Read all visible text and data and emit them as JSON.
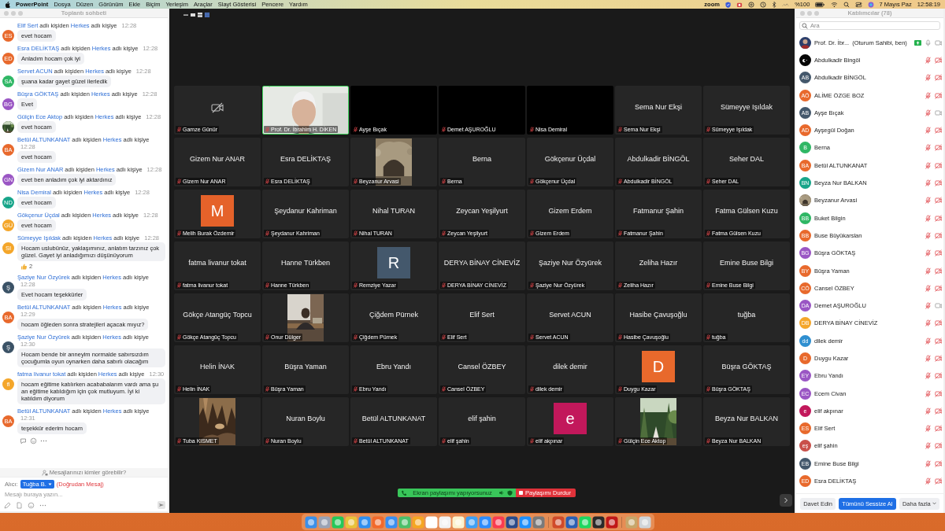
{
  "menubar": {
    "app": "PowerPoint",
    "menus": [
      "Dosya",
      "Düzen",
      "Görünüm",
      "Ekle",
      "Biçim",
      "Yerleşim",
      "Araçlar",
      "Slayt Gösterisi",
      "Pencere",
      "Yardım"
    ],
    "zoom_label": "zoom",
    "battery": "%100",
    "date": "7 Mayıs Paz",
    "time": "12:58:19"
  },
  "chat": {
    "title": "Toplantı sohbeti",
    "messages": [
      {
        "sender": "Elif Sert",
        "from_text": "adlı kişiden",
        "recipient": "Herkes",
        "to_text": "adlı kişiye",
        "time": "12:28",
        "kind": "initials",
        "initials": "ES",
        "color": "#e8692c",
        "text": "evet hocam"
      },
      {
        "sender": "Esra DELİKTAŞ",
        "from_text": "adlı kişiden",
        "recipient": "Herkes",
        "to_text": "adlı kişiye",
        "time": "12:28",
        "kind": "initials",
        "initials": "ED",
        "color": "#e8692c",
        "text": "Anladım hocam çok iyi"
      },
      {
        "sender": "Servet ACUN",
        "from_text": "adlı kişiden",
        "recipient": "Herkes",
        "to_text": "adlı kişiye",
        "time": "12:28",
        "kind": "initials",
        "initials": "SA",
        "color": "#2fb765",
        "text": "şuana kadar gayet güzel ilerledik"
      },
      {
        "sender": "Büşra GÖKTAŞ",
        "from_text": "adlı kişiden",
        "recipient": "Herkes",
        "to_text": "adlı kişiye",
        "time": "12:28",
        "kind": "initials",
        "initials": "BG",
        "color": "#9a56c4",
        "text": "Evet"
      },
      {
        "sender": "Gülçin Ece Aktop",
        "from_text": "adlı kişiden",
        "recipient": "Herkes",
        "to_text": "adlı kişiye",
        "time": "12:28",
        "kind": "picture",
        "text": "evet hocam"
      },
      {
        "sender": "Betül ALTUNKANAT",
        "from_text": "adlı kişiden",
        "recipient": "Herkes",
        "to_text": "adlı kişiye",
        "time": "12:28",
        "kind": "initials",
        "initials": "BA",
        "color": "#e8692c",
        "text": "evet hocam"
      },
      {
        "sender": "Gizem Nur ANAR",
        "from_text": "adlı kişiden",
        "recipient": "Herkes",
        "to_text": "adlı kişiye",
        "time": "12:28",
        "kind": "initials",
        "initials": "GN",
        "color": "#9a56c4",
        "text": "evet ben anladım çok iyi aktardınız"
      },
      {
        "sender": "Nisa Demiral",
        "from_text": "adlı kişiden",
        "recipient": "Herkes",
        "to_text": "adlı kişiye",
        "time": "12:28",
        "kind": "initials",
        "initials": "ND",
        "color": "#18a58a",
        "text": "evet hocam"
      },
      {
        "sender": "Gökçenur Üçdal",
        "from_text": "adlı kişiden",
        "recipient": "Herkes",
        "to_text": "adlı kişiye",
        "time": "12:28",
        "kind": "initials",
        "initials": "GÜ",
        "color": "#f4a62a",
        "text": "evet hocam"
      },
      {
        "sender": "Sümeyye Işıldak",
        "from_text": "adlı kişiden",
        "recipient": "Herkes",
        "to_text": "adlı kişiye",
        "time": "12:28",
        "kind": "initials",
        "initials": "SI",
        "color": "#f4a62a",
        "text": "Hocam uslubünüz, yaklaşımınız, anlatım tarzınız çok güzel. Gayet iyi anladığımızı düşünüyorum",
        "reaction_count": "2"
      },
      {
        "sender": "Şaziye Nur Özyürek",
        "from_text": "adlı kişiden",
        "recipient": "Herkes",
        "to_text": "adlı kişiye",
        "time": "12:28",
        "kind": "initials",
        "initials": "Ş",
        "color": "#3b5266",
        "text": "Evet hocam teşekkürler"
      },
      {
        "sender": "Betül ALTUNKANAT",
        "from_text": "adlı kişiden",
        "recipient": "Herkes",
        "to_text": "adlı kişiye",
        "time": "12:29",
        "kind": "initials",
        "initials": "BA",
        "color": "#e8692c",
        "text": "hocam öğleden sonra stratejileri açacak mıyız?"
      },
      {
        "sender": "Şaziye Nur Özyürek",
        "from_text": "adlı kişiden",
        "recipient": "Herkes",
        "to_text": "adlı kişiye",
        "time": "12:30",
        "kind": "initials",
        "initials": "Ş",
        "color": "#3b5266",
        "text": "Hocam bende bir anneyim normalde sabırsızdım çocuğumla oyun oynarken daha sabırlı olacağım"
      },
      {
        "sender": "fatma livanur tokat",
        "from_text": "adlı kişiden",
        "recipient": "Herkes",
        "to_text": "adlı kişiye",
        "time": "12:30",
        "kind": "initials",
        "initials": "fl",
        "color": "#f4a62a",
        "text": "hocam eğitime katılırken acababalarım vardı ama şu an eğitime katıldığım için çok mutluyum. İyi ki katıldım diyorum"
      },
      {
        "sender": "Betül ALTUNKANAT",
        "from_text": "adlı kişiden",
        "recipient": "Herkes",
        "to_text": "adlı kişiye",
        "time": "12:31",
        "kind": "initials",
        "initials": "BA",
        "color": "#e8692c",
        "text": "teşekkür ederim hocam"
      }
    ],
    "visibility_note": "Mesajlarınızı kimler görebilir?",
    "to_label": "Alıcı:",
    "recipient_button": "Tuğba B.",
    "direct_note": "(Doğrudan Mesaj)",
    "input": {
      "placeholder": "Mesajı buraya yazın..."
    }
  },
  "meeting": {
    "tiles": [
      {
        "kind": "camera_off",
        "label": "Gamze Günür",
        "speaking": false
      },
      {
        "kind": "video",
        "label": "Prof. Dr. İbrahim H. DİKEN",
        "speaking": true
      },
      {
        "kind": "blank",
        "label": "Ayşe Bıçak",
        "speaking": false
      },
      {
        "kind": "blank",
        "label": "Demet AŞUROĞLU",
        "speaking": false
      },
      {
        "kind": "blank",
        "label": "Nisa Demiral",
        "speaking": false
      },
      {
        "kind": "name",
        "display": "Sema Nur Ekşi",
        "label": "Sema Nur Ekşi",
        "speaking": false
      },
      {
        "kind": "name",
        "display": "Sümeyye Işıldak",
        "label": "Sümeyye Işıldak",
        "speaking": false
      },
      {
        "kind": "name",
        "display": "Gizem Nur ANAR",
        "label": "Gizem Nur ANAR",
        "speaking": false
      },
      {
        "kind": "name",
        "display": "Esra DELİKTAŞ",
        "label": "Esra DELİKTAŞ",
        "speaking": false
      },
      {
        "kind": "picture",
        "label": "Beyzanur Arvasi",
        "speaking": false
      },
      {
        "kind": "name",
        "display": "Berna",
        "label": "Berna",
        "speaking": false
      },
      {
        "kind": "name",
        "display": "Gökçenur Üçdal",
        "label": "Gökçenur Üçdal",
        "speaking": false
      },
      {
        "kind": "name",
        "display": "Abdulkadir BİNGÖL",
        "label": "Abdulkadir BİNGÖL",
        "speaking": false
      },
      {
        "kind": "name",
        "display": "Seher DAL",
        "label": "Seher DAL",
        "speaking": false
      },
      {
        "kind": "letter",
        "letter": "M",
        "color": "#e5622a",
        "label": "Melih Burak Özdemir",
        "speaking": false
      },
      {
        "kind": "name",
        "display": "Şeydanur Kahriman",
        "label": "Şeydanur Kahriman",
        "speaking": false
      },
      {
        "kind": "name",
        "display": "Nihal TURAN",
        "label": "Nihal TURAN",
        "speaking": false
      },
      {
        "kind": "name",
        "display": "Zeycan Yeşilyurt",
        "label": "Zeycan Yeşilyurt",
        "speaking": false
      },
      {
        "kind": "name",
        "display": "Gizem Erdem",
        "label": "Gizem Erdem",
        "speaking": false
      },
      {
        "kind": "name",
        "display": "Fatmanur Şahin",
        "label": "Fatmanur Şahin",
        "speaking": false
      },
      {
        "kind": "name",
        "display": "Fatma Gülsen Kuzu",
        "label": "Fatma Gülsen Kuzu",
        "speaking": false
      },
      {
        "kind": "name",
        "display": "fatma livanur tokat",
        "label": "fatma livanur tokat",
        "speaking": false
      },
      {
        "kind": "name",
        "display": "Hanne Türkben",
        "label": "Hanne Türkben",
        "speaking": false
      },
      {
        "kind": "letter",
        "letter": "R",
        "color": "#44586c",
        "label": "Remziye Yazar",
        "speaking": false
      },
      {
        "kind": "name",
        "display": "DERYA BİNAY CİNEVİZ",
        "label": "DERYA BİNAY CİNEVİZ",
        "speaking": false
      },
      {
        "kind": "name",
        "display": "Şaziye Nur Özyürek",
        "label": "Şaziye Nur Özyürek",
        "speaking": false
      },
      {
        "kind": "name",
        "display": "Zeliha Hazır",
        "label": "Zeliha Hazır",
        "speaking": false
      },
      {
        "kind": "name",
        "display": "Emine Buse Bilgi",
        "label": "Emine Buse Bilgi",
        "speaking": false
      },
      {
        "kind": "name",
        "display": "Gökçe Atangüç Topcu",
        "label": "Gökçe Atangüç Topcu",
        "speaking": false
      },
      {
        "kind": "picture",
        "label": "Onur Dülger",
        "speaking": false
      },
      {
        "kind": "name",
        "display": "Çiğdem Pürnek",
        "label": "Çiğdem Pürnek",
        "speaking": false
      },
      {
        "kind": "name",
        "display": "Elif Sert",
        "label": "Elif Sert",
        "speaking": false
      },
      {
        "kind": "name",
        "display": "Servet ACUN",
        "label": "Servet ACUN",
        "speaking": false
      },
      {
        "kind": "name",
        "display": "Hasibe Çavuşoğlu",
        "label": "Hasibe Çavuşoğlu",
        "speaking": false
      },
      {
        "kind": "name",
        "display": "tuğba",
        "label": "tuğba",
        "speaking": false
      },
      {
        "kind": "name",
        "display": "Helin İNAK",
        "label": "Helin İNAK",
        "speaking": false
      },
      {
        "kind": "name",
        "display": "Büşra Yaman",
        "label": "Büşra Yaman",
        "speaking": false
      },
      {
        "kind": "name",
        "display": "Ebru Yandı",
        "label": "Ebru Yandı",
        "speaking": false
      },
      {
        "kind": "name",
        "display": "Cansel ÖZBEY",
        "label": "Cansel ÖZBEY",
        "speaking": false
      },
      {
        "kind": "name",
        "display": "dilek demir",
        "label": "dilek demir",
        "speaking": false
      },
      {
        "kind": "letter",
        "letter": "D",
        "color": "#e8692c",
        "label": "Duygu Kazar",
        "speaking": false
      },
      {
        "kind": "name",
        "display": "Büşra GÖKTAŞ",
        "label": "Büşra GÖKTAŞ",
        "speaking": false
      },
      {
        "kind": "picture",
        "label": "Tuba KISMET",
        "speaking": false
      },
      {
        "kind": "name",
        "display": "Nuran Boylu",
        "label": "Nuran Boylu",
        "speaking": false
      },
      {
        "kind": "name",
        "display": "Betül ALTUNKANAT",
        "label": "Betül ALTUNKANAT",
        "speaking": false
      },
      {
        "kind": "name",
        "display": "elif şahin",
        "label": "elif şahin",
        "speaking": false
      },
      {
        "kind": "letter",
        "letter": "e",
        "color": "#c2185b",
        "label": "elif akpınar",
        "speaking": false
      },
      {
        "kind": "picture",
        "label": "Gülçin Ece Aktop",
        "speaking": false
      },
      {
        "kind": "name",
        "display": "Beyza Nur BALKAN",
        "label": "Beyza Nur BALKAN",
        "speaking": false
      }
    ],
    "share_status": "Ekran paylaşımı yapıyorsunuz",
    "stop_button": "Paylaşımı Durdur"
  },
  "participants": {
    "title": "Katılımcılar (78)",
    "search": {
      "placeholder": "Ara"
    },
    "items": [
      {
        "name": "Prof. Dr. İbr...",
        "note": "(Oturum Sahibi, ben)",
        "kind": "picture",
        "sharing": true,
        "muted": false,
        "video_on": true
      },
      {
        "name": "Abdulkadir Bingöl",
        "kind": "picture",
        "sharing": false,
        "muted": true,
        "video_on": false
      },
      {
        "name": "Abdulkadir BİNGÖL",
        "kind": "initials",
        "initials": "AB",
        "color": "#44586c",
        "sharing": false,
        "muted": true,
        "video_on": false
      },
      {
        "name": "ALİME ÖZGE BOZ",
        "kind": "initials",
        "initials": "AÖ",
        "color": "#e8692c",
        "sharing": false,
        "muted": true,
        "video_on": false
      },
      {
        "name": "Ayşe Bıçak",
        "kind": "initials",
        "initials": "AB",
        "color": "#44586c",
        "sharing": false,
        "muted": true,
        "video_on": true
      },
      {
        "name": "Ayşegül Doğan",
        "kind": "initials",
        "initials": "AD",
        "color": "#e8692c",
        "sharing": false,
        "muted": true,
        "video_on": false
      },
      {
        "name": "Berna",
        "kind": "initials",
        "initials": "B",
        "color": "#2fb765",
        "sharing": false,
        "muted": true,
        "video_on": false
      },
      {
        "name": "Betül ALTUNKANAT",
        "kind": "initials",
        "initials": "BA",
        "color": "#e8692c",
        "sharing": false,
        "muted": true,
        "video_on": false
      },
      {
        "name": "Beyza Nur BALKAN",
        "kind": "initials",
        "initials": "BN",
        "color": "#18a58a",
        "sharing": false,
        "muted": true,
        "video_on": false
      },
      {
        "name": "Beyzanur Arvasi",
        "kind": "picture",
        "sharing": false,
        "muted": true,
        "video_on": false
      },
      {
        "name": "Buket Bilgin",
        "kind": "initials",
        "initials": "BB",
        "color": "#2fb765",
        "sharing": false,
        "muted": true,
        "video_on": false
      },
      {
        "name": "Buse Büyükarslan",
        "kind": "initials",
        "initials": "BB",
        "color": "#e8692c",
        "sharing": false,
        "muted": true,
        "video_on": false
      },
      {
        "name": "Büşra GÖKTAŞ",
        "kind": "initials",
        "initials": "BG",
        "color": "#9a56c4",
        "sharing": false,
        "muted": true,
        "video_on": false
      },
      {
        "name": "Büşra Yaman",
        "kind": "initials",
        "initials": "BY",
        "color": "#e8692c",
        "sharing": false,
        "muted": true,
        "video_on": false
      },
      {
        "name": "Cansel ÖZBEY",
        "kind": "initials",
        "initials": "CÖ",
        "color": "#e8692c",
        "sharing": false,
        "muted": true,
        "video_on": false
      },
      {
        "name": "Demet AŞUROĞLU",
        "kind": "initials",
        "initials": "DA",
        "color": "#9a56c4",
        "sharing": false,
        "muted": true,
        "video_on": true
      },
      {
        "name": "DERYA BİNAY CİNEVİZ",
        "kind": "initials",
        "initials": "DB",
        "color": "#f4a62a",
        "sharing": false,
        "muted": true,
        "video_on": false
      },
      {
        "name": "dilek demir",
        "kind": "initials",
        "initials": "dd",
        "color": "#2f8fd0",
        "sharing": false,
        "muted": true,
        "video_on": false
      },
      {
        "name": "Duygu Kazar",
        "kind": "initials",
        "initials": "D",
        "color": "#e8692c",
        "sharing": false,
        "muted": true,
        "video_on": false
      },
      {
        "name": "Ebru Yandı",
        "kind": "initials",
        "initials": "EY",
        "color": "#9a56c4",
        "sharing": false,
        "muted": true,
        "video_on": false
      },
      {
        "name": "Ecem Civan",
        "kind": "initials",
        "initials": "EC",
        "color": "#9a56c4",
        "sharing": false,
        "muted": true,
        "video_on": false
      },
      {
        "name": "elif akpınar",
        "kind": "initials",
        "initials": "e",
        "color": "#c2185b",
        "sharing": false,
        "muted": true,
        "video_on": false
      },
      {
        "name": "Elif Sert",
        "kind": "initials",
        "initials": "ES",
        "color": "#e8692c",
        "sharing": false,
        "muted": true,
        "video_on": false
      },
      {
        "name": "elif şahin",
        "kind": "initials",
        "initials": "eş",
        "color": "#c9504a",
        "sharing": false,
        "muted": true,
        "video_on": false
      },
      {
        "name": "Emine Buse Bilgi",
        "kind": "initials",
        "initials": "EB",
        "color": "#44586c",
        "sharing": false,
        "muted": true,
        "video_on": false
      },
      {
        "name": "Esra DELİKTAŞ",
        "kind": "initials",
        "initials": "ED",
        "color": "#e8692c",
        "sharing": false,
        "muted": true,
        "video_on": false
      }
    ],
    "buttons": [
      {
        "label": "Davet Edin",
        "kind": "plain"
      },
      {
        "label": "Tümünü Sessize Al",
        "kind": "primary"
      },
      {
        "label": "Daha fazla",
        "kind": "menu"
      }
    ]
  }
}
